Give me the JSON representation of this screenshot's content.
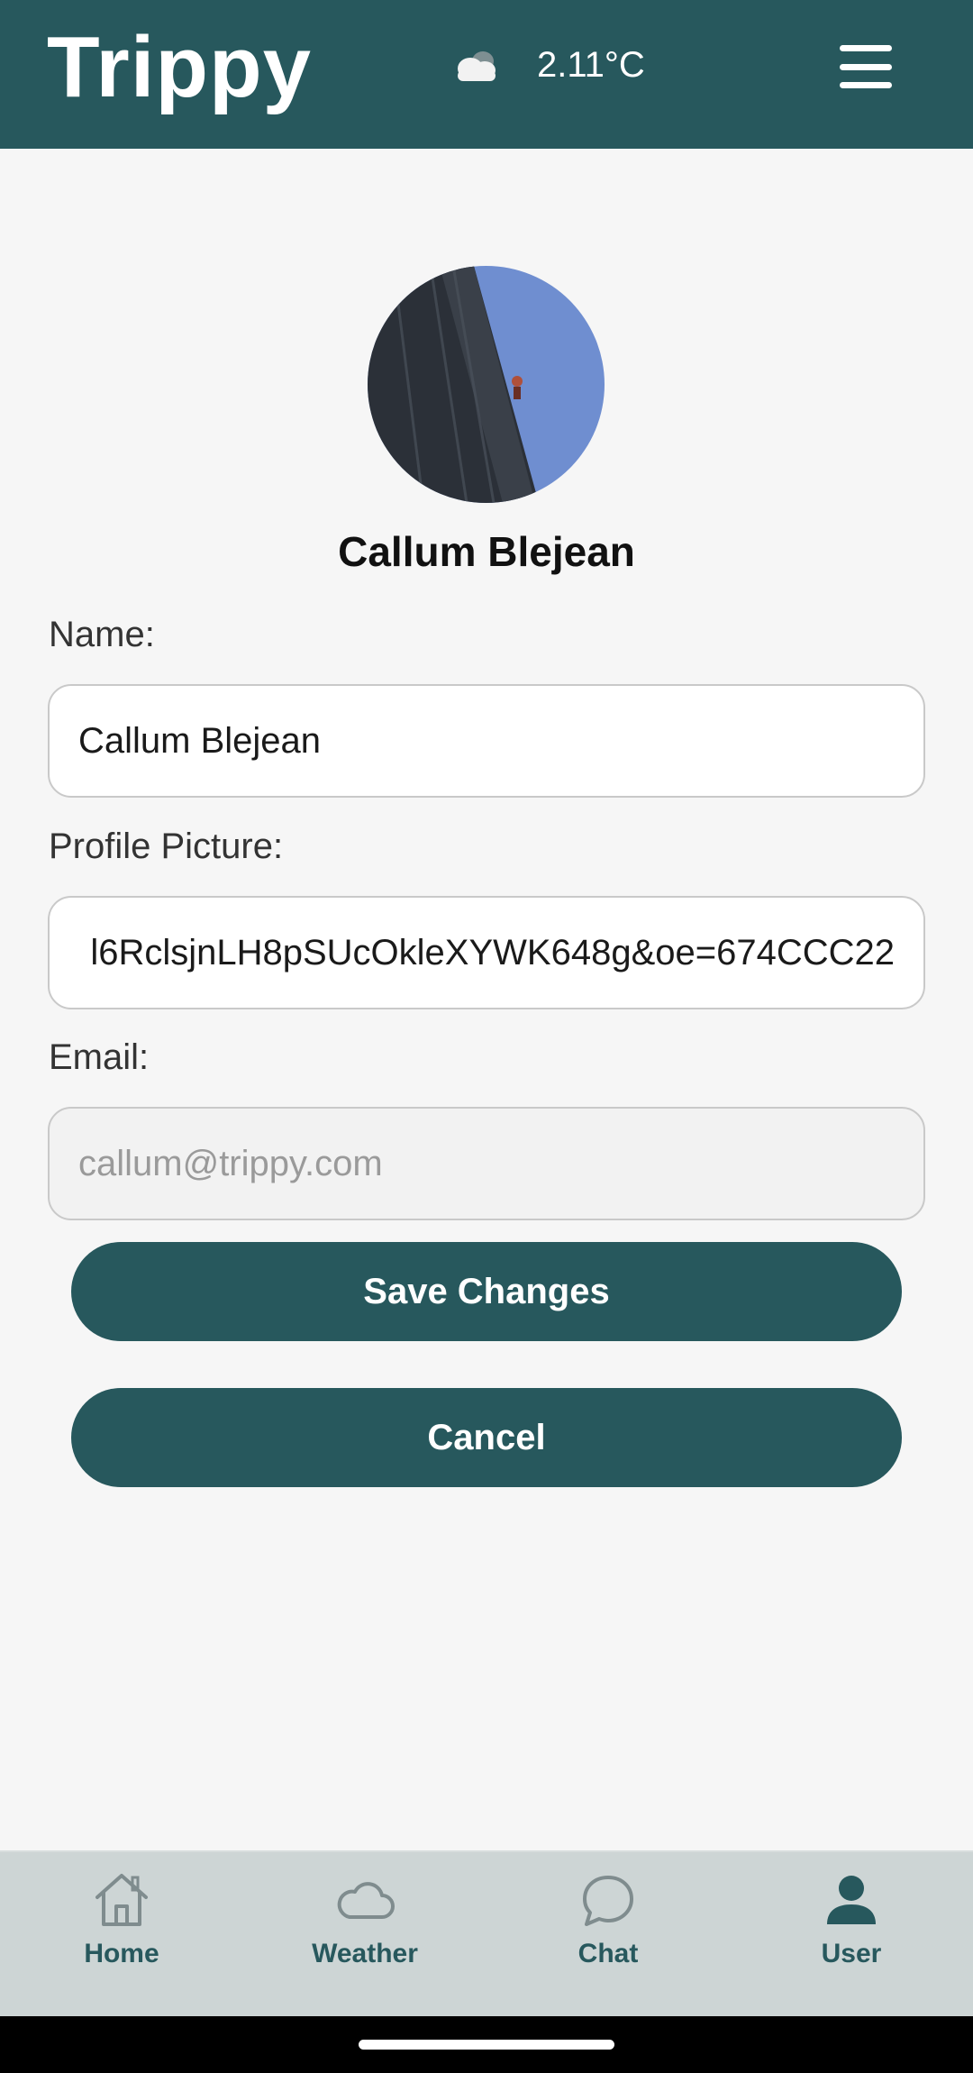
{
  "header": {
    "app_title": "Trippy",
    "weather_icon": "cloud-icon",
    "temperature": "2.11°C",
    "menu_icon": "hamburger-menu-icon"
  },
  "profile": {
    "display_name": "Callum Blejean",
    "avatar_icon": "avatar"
  },
  "form": {
    "name_label": "Name:",
    "name_value": "Callum Blejean",
    "picture_label": "Profile Picture:",
    "picture_value": "l6RclsjnLH8pSUcOkleXYWK648g&oe=674CCC22",
    "email_label": "Email:",
    "email_placeholder": "callum@trippy.com"
  },
  "actions": {
    "save_label": "Save Changes",
    "cancel_label": "Cancel"
  },
  "bottom_nav": {
    "items": [
      {
        "label": "Home",
        "icon": "home-icon"
      },
      {
        "label": "Weather",
        "icon": "cloud-icon"
      },
      {
        "label": "Chat",
        "icon": "chat-bubble-icon"
      },
      {
        "label": "User",
        "icon": "user-icon",
        "active": true
      }
    ]
  },
  "colors": {
    "primary": "#27585d",
    "background": "#f6f6f6",
    "nav_background": "#cdd5d5"
  }
}
